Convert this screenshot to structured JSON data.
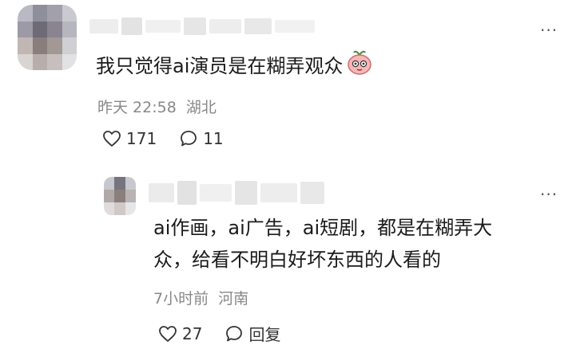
{
  "comment": {
    "text": "我只觉得ai演员是在糊弄观众",
    "emoji": "peach-face-emoji",
    "time": "昨天 22:58",
    "location": "湖北",
    "likes": "171",
    "replies": "11",
    "more": "···"
  },
  "reply": {
    "text_line1": "ai作画，ai广告，ai短剧，都是在糊弄大",
    "text_line2": "众，给看不明白好坏东西的人看的",
    "time": "7小时前",
    "location": "河南",
    "likes": "27",
    "reply_label": "回复",
    "more": "···"
  },
  "colors": {
    "text": "#1a1a1a",
    "meta": "#888888",
    "icon": "#333333"
  }
}
